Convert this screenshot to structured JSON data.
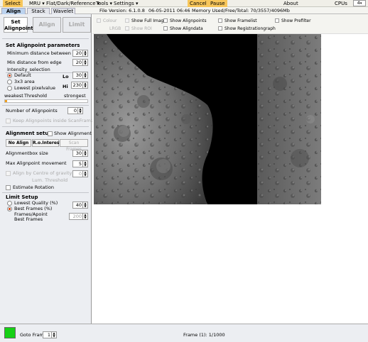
{
  "menubar": {
    "select": "Select",
    "mru": "MRU",
    "flat": "Flat/Dark/Reference",
    "tools": "Tools",
    "settings": "Settings",
    "cancel": "Cancel",
    "pause": "Pause",
    "about": "About",
    "cpus_label": "CPUs",
    "cpus_value": "4"
  },
  "tabs": {
    "align": "Align",
    "stack": "Stack",
    "wavelet": "Wavelet"
  },
  "info": {
    "file_version": "File Version: 6.1.0.8",
    "date": "06-05-2011 06:46",
    "memory": "Memory Used/Free/Total: 70/3557/4096Mb"
  },
  "subtabs": {
    "set_alignpoints_line1": "Set",
    "set_alignpoints_line2": "Alignpoints",
    "align": "Align",
    "limit": "Limit"
  },
  "params": {
    "header": "Set Alignpoint parameters",
    "min_distance_label": "Minimum distance between",
    "min_distance_value": "20",
    "min_edge_label": "Min distance from edge",
    "min_edge_value": "20",
    "intensity_label": "Intensity_selection",
    "default_label": "Default",
    "area_label": "3x3 area",
    "lowest_label": "Lowest pixelvalue",
    "lo_label": "Lo",
    "lo_value": "30",
    "hi_label": "Hi",
    "hi_value": "230",
    "weakest": "weakest",
    "threshold": "Threshold",
    "strongest": "strongest",
    "threshold_value": 0.0
  },
  "alignpoints": {
    "number_label": "Number of Alignpoints",
    "number_value": "0",
    "keep_label": "Keep Alignpoints inside ScanFrame"
  },
  "setup": {
    "header": "Alignment setup",
    "show_alignment": "Show Alignment",
    "no_align": "No Align",
    "r_interest": "R.o.Interest",
    "scan_frames": "Scan Frames",
    "box_size_label": "Alignmentbox size",
    "box_size_value": "30",
    "max_move_label": "Max Alignpoint movement",
    "max_move_value": "5",
    "centre_gravity_label": "Align by Centre of gravity",
    "centre_gravity_value": "0",
    "lum_threshold_label": "Lum. Threshold",
    "estimate_rotation": "Estimate Rotation"
  },
  "limit": {
    "header": "Limit Setup",
    "lowest_quality_label": "Lowest Quality (%)",
    "best_frames_pct_label": "Best Frames (%)",
    "best_frames_pct_value": "40",
    "frames_apoint_label": "Frames/Apoint",
    "best_frames_label": "Best Frames",
    "best_frames_value": "200"
  },
  "view_options": {
    "colour": "Colour",
    "lrgb": "LRGB",
    "show_full_image": "Show Full Image",
    "show_roi": "Show ROI",
    "show_alignpoints": "Show Alignpoints",
    "show_aligndata": "Show Aligndata",
    "show_framelist": "Show Framelist",
    "show_registrationgraph": "Show Registrationgraph",
    "show_prefilter": "Show Prefilter"
  },
  "bottom": {
    "goto_frame_label": "Goto Frame",
    "goto_frame_value": "1",
    "frame_status": "Frame (1): 1/1000",
    "status_color": "#16d016"
  },
  "colors": {
    "accent_orange": "#f7c65a",
    "tab_active": "#bcd3ef",
    "radio_selected": "#d04010"
  }
}
